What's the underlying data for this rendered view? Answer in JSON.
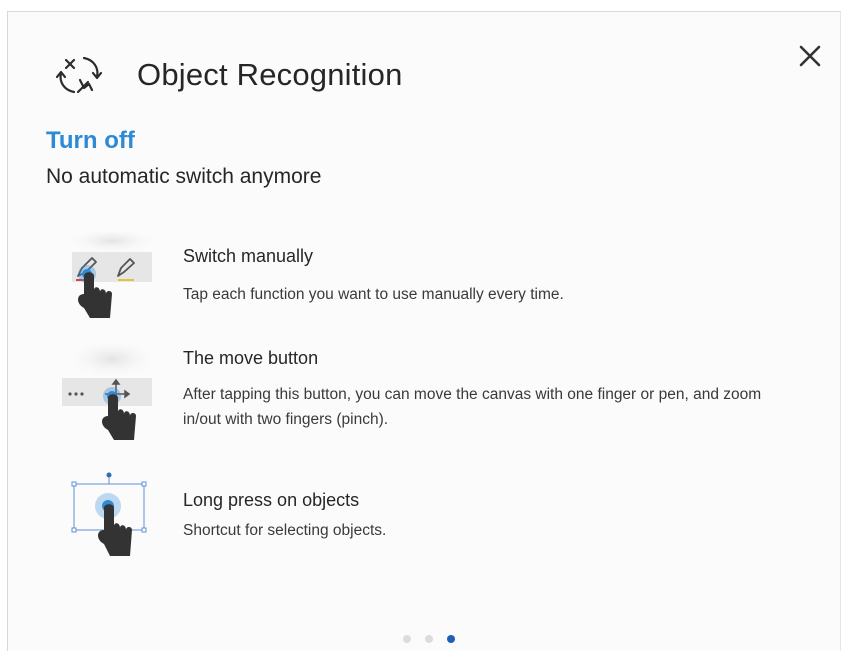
{
  "dialog": {
    "title": "Object Recognition",
    "header_icon": "auto-switch-icon",
    "close_icon": "close-icon"
  },
  "section": {
    "heading": "Turn off",
    "subheading": "No automatic switch anymore"
  },
  "features": [
    {
      "title": "Switch manually",
      "description": "Tap each function you want to use manually every time.",
      "icon": "switch-manually-illustration"
    },
    {
      "title": "The move button",
      "description": "After tapping this button, you can move the canvas with one finger or pen, and zoom in/out with two fingers (pinch).",
      "icon": "move-button-illustration"
    },
    {
      "title": "Long press on objects",
      "description": "Shortcut for selecting objects.",
      "icon": "long-press-illustration"
    }
  ],
  "pagination": {
    "total": 3,
    "active_index": 2
  },
  "colors": {
    "accent": "#2f8ad6",
    "active_dot": "#1f5fb8",
    "inactive_dot": "#dcdcdc",
    "text": "#262626",
    "panel_bg": "#fbfbfc"
  }
}
